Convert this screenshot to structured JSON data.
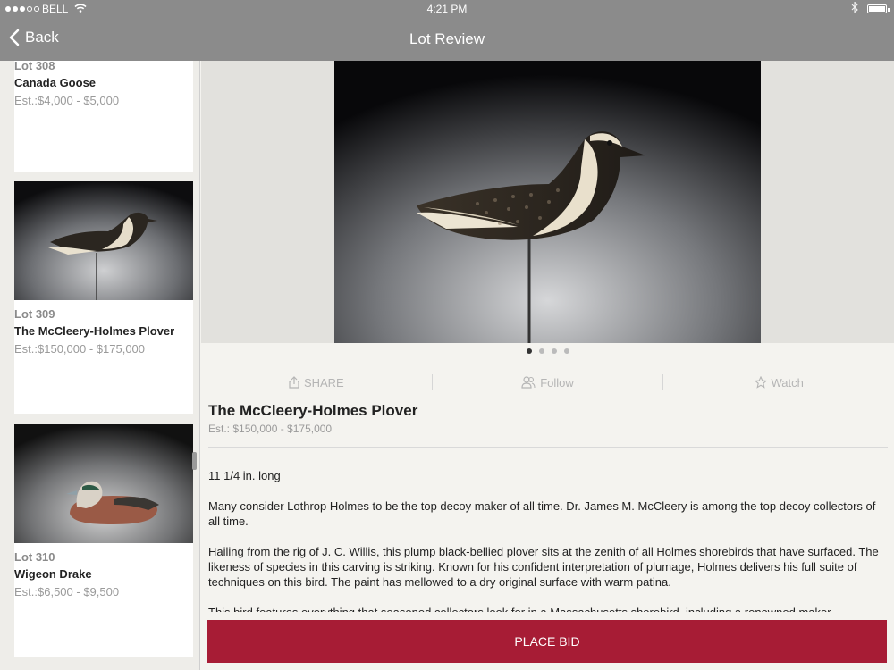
{
  "status": {
    "carrier": "BELL",
    "time": "4:21 PM"
  },
  "nav": {
    "back_label": "Back",
    "title": "Lot Review"
  },
  "sidebar": {
    "lots": [
      {
        "number": "Lot 308",
        "name": "Canada Goose",
        "estimate": "Est.:$4,000 - $5,000"
      },
      {
        "number": "Lot 309",
        "name": "The McCleery-Holmes Plover",
        "estimate": "Est.:$150,000 - $175,000"
      },
      {
        "number": "Lot 310",
        "name": "Wigeon Drake",
        "estimate": "Est.:$6,500 - $9,500"
      }
    ]
  },
  "gallery": {
    "page_count": 4,
    "active_page": 1
  },
  "actions": {
    "share": "SHARE",
    "follow": "Follow",
    "watch": "Watch"
  },
  "detail": {
    "title": "The McCleery-Holmes Plover",
    "estimate": "Est.: $150,000 - $175,000",
    "paragraphs": [
      "11 1/4 in. long",
      "Many consider Lothrop Holmes to be the top decoy maker of all time. Dr. James M. McCleery is among the top decoy collectors of all time.",
      "Hailing from the rig of J. C. Willis, this plump black-bellied plover sits at the zenith of all Holmes shorebirds that have surfaced. The likeness of species in this carving is striking. Known for his confident interpretation of plumage, Holmes delivers his full suite of techniques on this bird. The paint has mellowed to a dry original surface with warm patina.",
      "This bird features everything that seasoned collectors look for in a Massachusetts shorebird, including a renowned maker, impeccable"
    ]
  },
  "bid": {
    "label": "PLACE BID"
  },
  "colors": {
    "nav_bar": "#8b8b8b",
    "bid_button": "#a71c35"
  }
}
